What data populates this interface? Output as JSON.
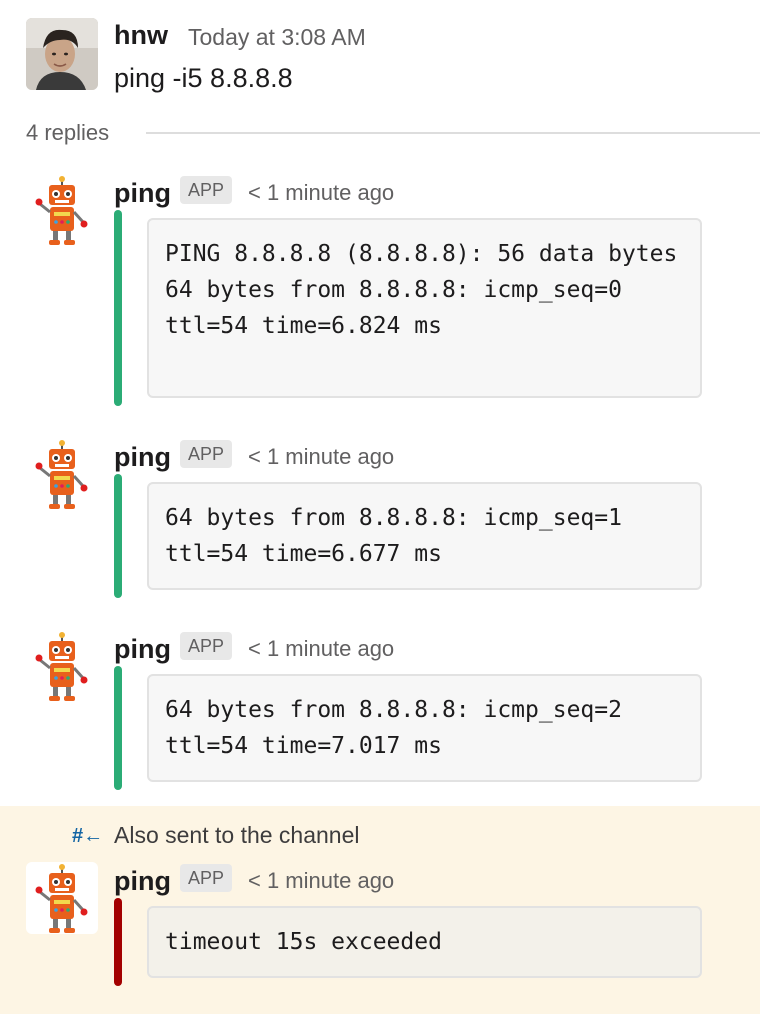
{
  "parent": {
    "author": "hnw",
    "time": "Today at 3:08 AM",
    "text": "ping -i5 8.8.8.8"
  },
  "thread": {
    "replies_label": "4 replies"
  },
  "replies": [
    {
      "author": "ping",
      "badge": "APP",
      "time": "< 1 minute ago",
      "bar_color": "#2bac76",
      "text": "PING 8.8.8.8 (8.8.8.8): 56 data bytes\n64 bytes from 8.8.8.8: icmp_seq=0 ttl=54 time=6.824 ms"
    },
    {
      "author": "ping",
      "badge": "APP",
      "time": "< 1 minute ago",
      "bar_color": "#2bac76",
      "text": "64 bytes from 8.8.8.8: icmp_seq=1 ttl=54 time=6.677 ms"
    },
    {
      "author": "ping",
      "badge": "APP",
      "time": "< 1 minute ago",
      "bar_color": "#2bac76",
      "text": "64 bytes from 8.8.8.8: icmp_seq=2 ttl=54 time=7.017 ms"
    }
  ],
  "broadcast": {
    "icon": "channel-broadcast-icon",
    "label": "Also sent to the channel",
    "author": "ping",
    "badge": "APP",
    "time": "< 1 minute ago",
    "bar_color": "#a30000",
    "background": "#fdf5e4",
    "text": "timeout 15s exceeded"
  }
}
